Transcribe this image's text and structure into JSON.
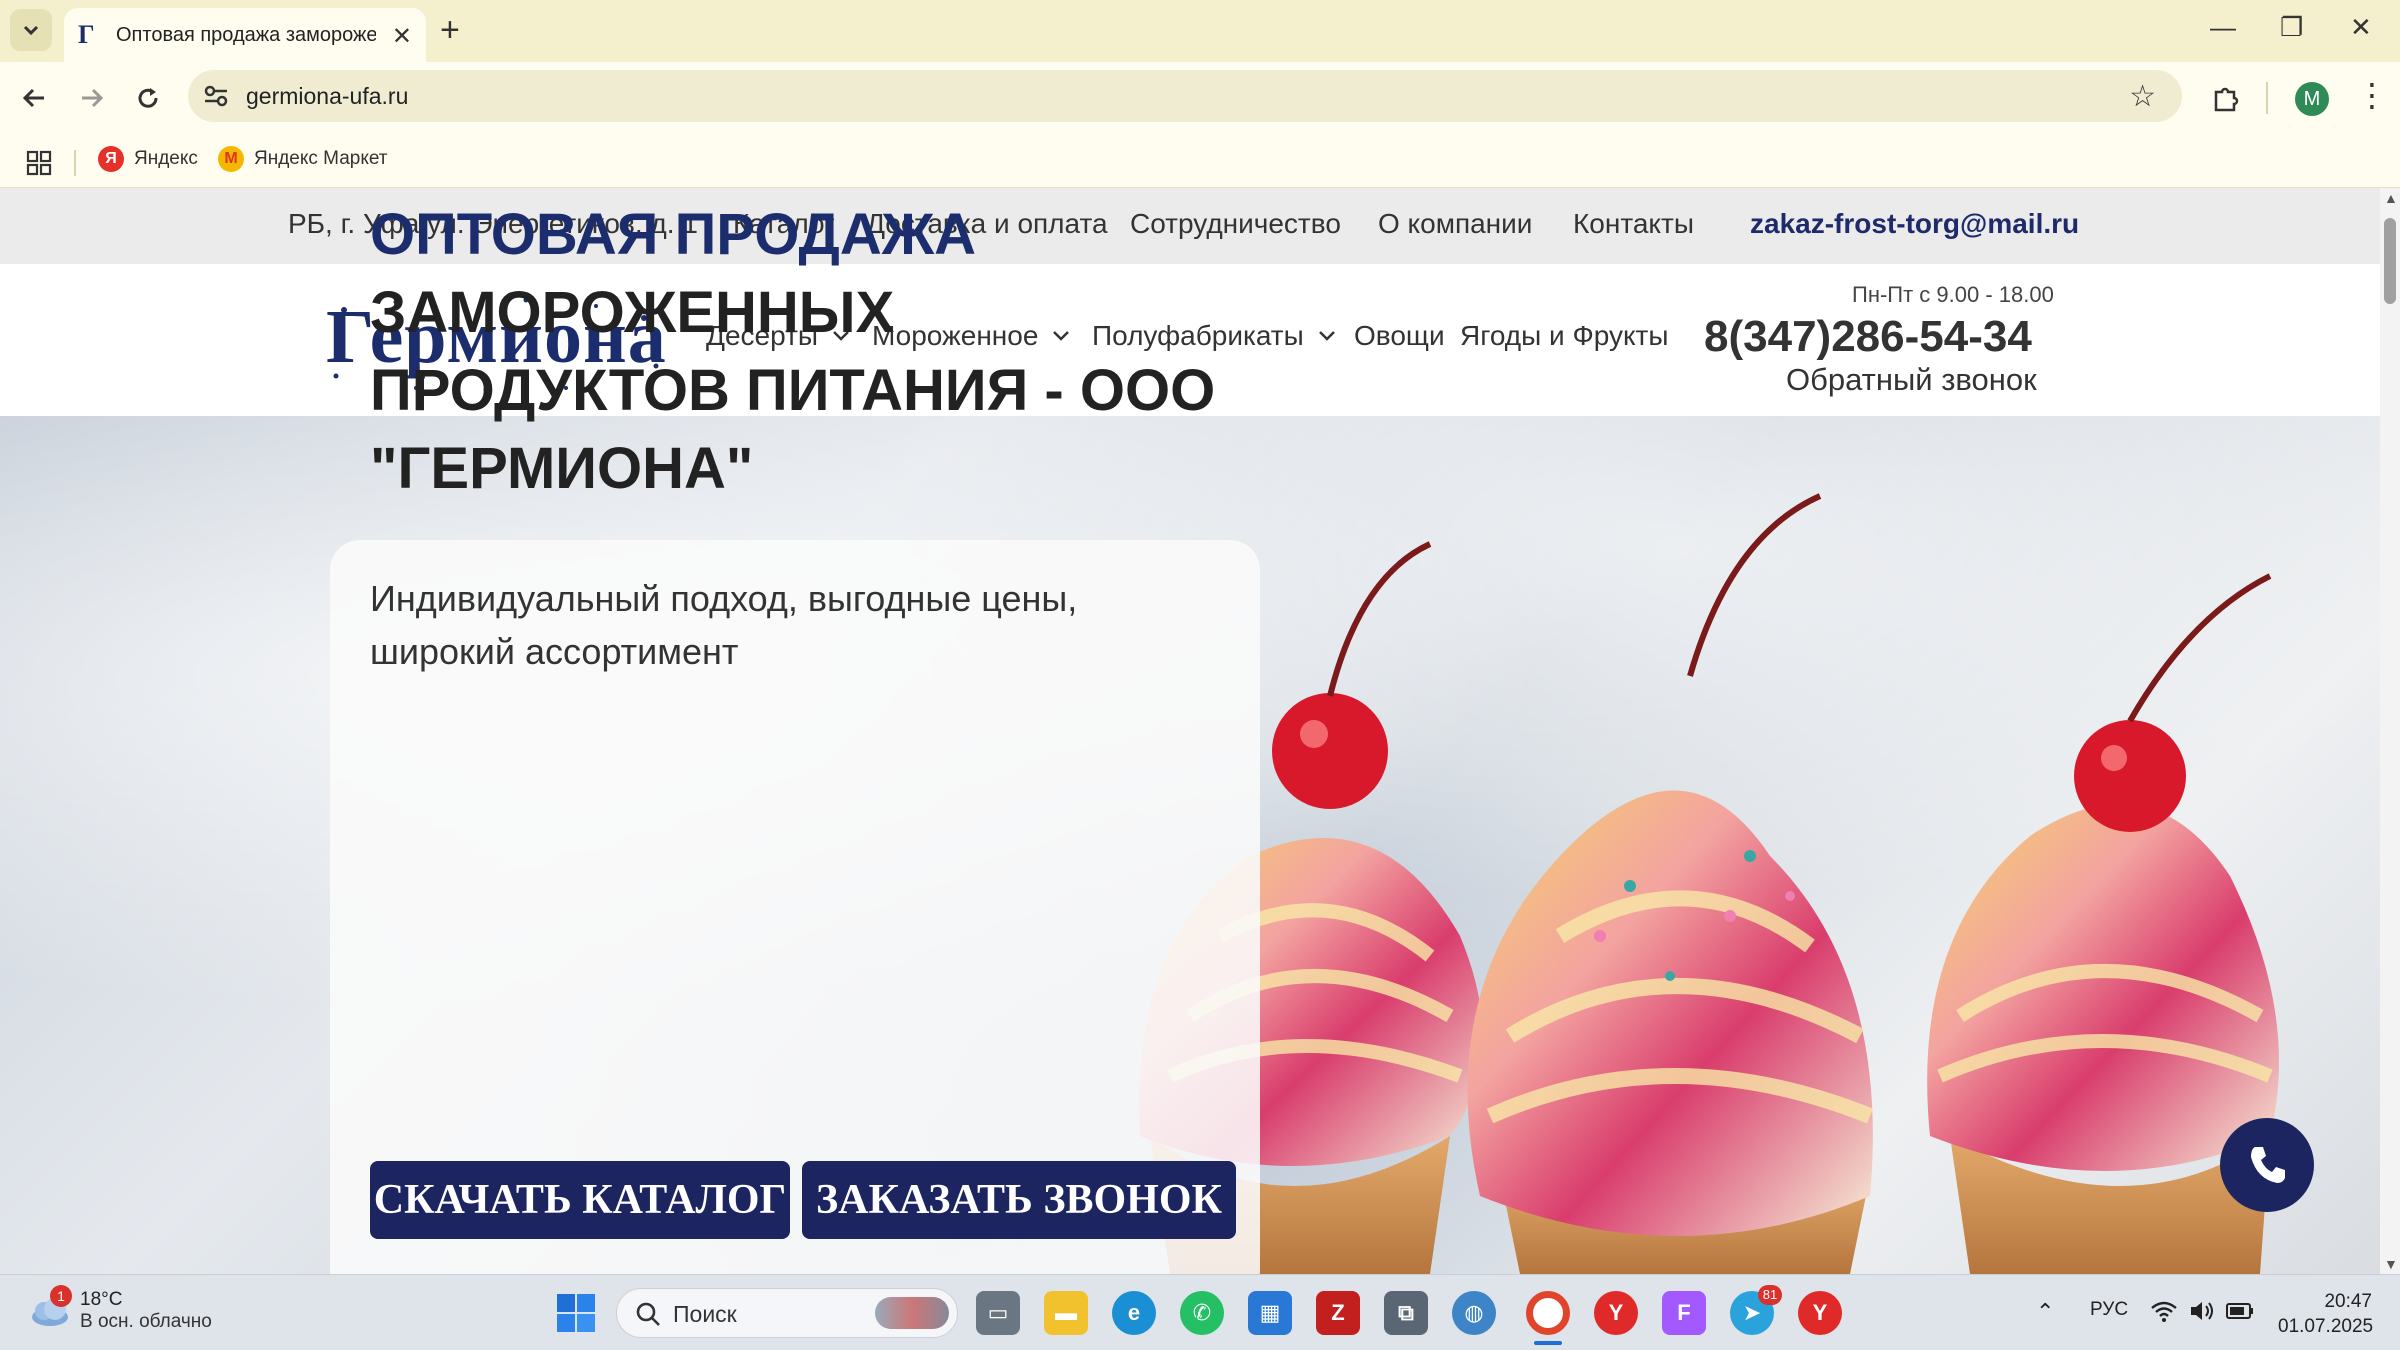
{
  "browser": {
    "tab_title": "Оптовая продажа заморожен",
    "url": "germiona-ufa.ru",
    "avatar_letter": "M",
    "bookmarks": [
      {
        "label": "Яндекс",
        "icon": "yandex-icon",
        "color": "#e5312a"
      },
      {
        "label": "Яндекс Маркет",
        "icon": "yandex-market-icon",
        "color": "#f5b800"
      }
    ]
  },
  "topbar": {
    "address": "РБ, г. Уфа ул. Энергетиков, д. 1",
    "links": [
      "Каталог",
      "Доставка и оплата",
      "Сотрудничество",
      "О компании",
      "Контакты"
    ],
    "email": "zakaz-frost-torg@mail.ru"
  },
  "header": {
    "logo": "Гермиона",
    "menu": [
      {
        "label": "Десерты",
        "dropdown": true
      },
      {
        "label": "Мороженное",
        "dropdown": true
      },
      {
        "label": "Полуфабрикаты",
        "dropdown": true
      },
      {
        "label": "Овощи",
        "dropdown": false
      },
      {
        "label": "Ягоды и Фрукты",
        "dropdown": false
      }
    ],
    "hours": "Пн-Пт с 9.00 - 18.00",
    "phone": "8(347)286-54-34",
    "callback": "Обратный звонок"
  },
  "hero": {
    "title_accent": "ОПТОВАЯ ПРОДАЖА",
    "title_rest": "ЗАМОРОЖЕННЫХ ПРОДУКТОВ ПИТАНИЯ - ООО \"ГЕРМИОНА\"",
    "subtitle": "Индивидуальный подход, выгодные цены, широкий ассортимент",
    "btn_catalog": "СКАЧАТЬ КАТАЛОГ",
    "btn_call": "ЗАКАЗАТЬ ЗВОНОК"
  },
  "taskbar": {
    "weather_temp": "18°C",
    "weather_desc": "В осн. облачно",
    "weather_badge": "1",
    "search_label": "Поиск",
    "telegram_badge": "81",
    "lang": "РУС",
    "time": "20:47",
    "date": "01.07.2025"
  },
  "colors": {
    "brand": "#1c2d6e",
    "button": "#1c2560",
    "chrome": "#f4f0cd"
  }
}
